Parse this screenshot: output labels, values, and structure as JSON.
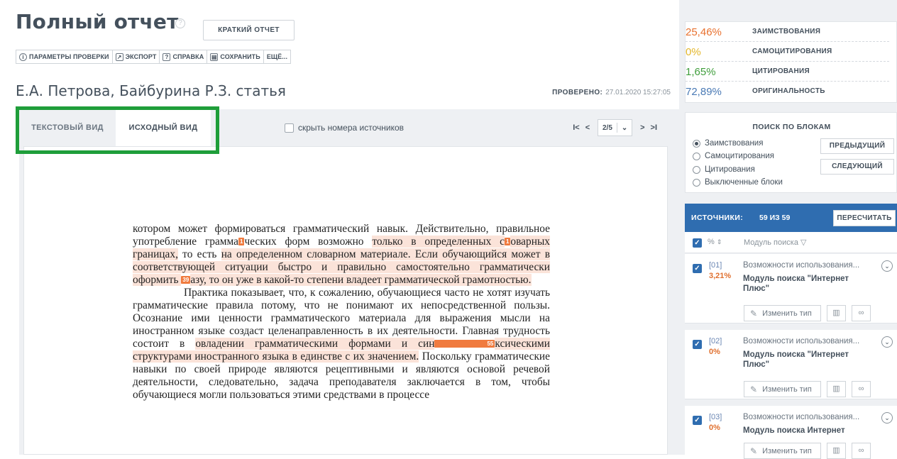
{
  "header": {
    "title": "Полный отчет",
    "short_report": "КРАТКИЙ ОТЧЕТ",
    "toolbar": [
      {
        "icon": "info-icon",
        "glyph": "i",
        "label": "ПАРАМЕТРЫ ПРОВЕРКИ"
      },
      {
        "icon": "export-icon",
        "glyph": "↗",
        "label": "ЭКСПОРТ"
      },
      {
        "icon": "help-icon",
        "glyph": "?",
        "label": "СПРАВКА"
      },
      {
        "icon": "save-icon",
        "glyph": "▤",
        "label": "СОХРАНИТЬ"
      },
      {
        "icon": "",
        "glyph": "",
        "label": "ЕЩЁ..."
      }
    ],
    "doc_name": "Е.А. Петрова, Байбурина Р.З. статья",
    "checked_label": "ПРОВЕРЕНО:",
    "checked_date": "27.01.2020 15:27:05"
  },
  "viewer": {
    "tab_text": "ТЕКСТОВЫЙ ВИД",
    "tab_original": "ИСХОДНЫЙ ВИД",
    "hide_sources": "скрыть номера источников",
    "page_current": "2/5",
    "highlight_color": "#1f9e3a"
  },
  "document": {
    "p1": [
      {
        "t": "котором может формироваться грамматический навык. Действительно, правильное употребление грамма",
        "h": false
      },
      {
        "m": "1"
      },
      {
        "t": "ческих форм возможно ",
        "h": false
      },
      {
        "t": "только в определенных с",
        "h": true
      },
      {
        "m": "1"
      },
      {
        "t": "оварных границах,",
        "h": true
      },
      {
        "t": " то есть ",
        "h": false
      },
      {
        "t": "на определенном словарном материале. Если ",
        "h": true
      },
      {
        "t": "обучающийся может в соответствующей ситуации быстро и правильно самостоятельно грамматически оформить ",
        "h": true
      },
      {
        "m": "39"
      },
      {
        "t": "азу, то он уже в какой-то степени владеет грамматической грамотностью.",
        "h": true
      }
    ],
    "p2": [
      {
        "t": "Практика показывает, что, к сожалению, обучающиеся часто не хотят изучать грамматические правила потому, что не понимают их непосредственной пользы. Осознание ими ценности грамматического материала для выражения мысли на иностранном языке создаст целенаправленность в их деятельности. Главная трудность состоит в ",
        "h": false
      },
      {
        "t": "овладении грамматическими формами и син",
        "h": true
      },
      {
        "m": "55"
      },
      {
        "t": "ксическими структурами иностранного языка в единстве с их значением.",
        "h": true
      },
      {
        "t": " Поскольку грамматические навыки по своей природе являются рецептивными и являются основой речевой деятельности, следовательно, задача преподавателя заключается в том, чтобы обучающиеся могли пользоваться этими средствами в процессе",
        "h": false
      }
    ]
  },
  "stats": [
    {
      "value": "25,46%",
      "label": "ЗАИМСТВОВАНИЯ",
      "color": "#e8712f"
    },
    {
      "value": "0%",
      "label": "САМОЦИТИРОВАНИЯ",
      "color": "#e3b62a"
    },
    {
      "value": "1,65%",
      "label": "ЦИТИРОВАНИЯ",
      "color": "#3f9e3c"
    },
    {
      "value": "72,89%",
      "label": "ОРИГИНАЛЬНОСТЬ",
      "color": "#4a7ab5"
    }
  ],
  "block_search": {
    "title": "ПОИСК ПО БЛОКАМ",
    "options": [
      "Заимствования",
      "Самоцитирования",
      "Цитирования",
      "Выключенные блоки"
    ],
    "prev": "ПРЕДЫДУЩИЙ",
    "next": "СЛЕДУЮЩИЙ"
  },
  "sources": {
    "label": "ИСТОЧНИКИ:",
    "count": "59 ИЗ 59",
    "recount": "ПЕРЕСЧИТАТЬ",
    "col_pct": "%",
    "col_module": "Модуль поиска",
    "change_type": "Изменить тип",
    "items": [
      {
        "num": "[01]",
        "pct": "3,21%",
        "title": "Возможности использования...",
        "module": "Модуль поиска \"Интернет Плюс\""
      },
      {
        "num": "[02]",
        "pct": "0%",
        "title": "Возможности использования...",
        "module": "Модуль поиска \"Интернет Плюс\""
      },
      {
        "num": "[03]",
        "pct": "0%",
        "title": "Возможности использования...",
        "module": "Модуль поиска Интернет"
      }
    ]
  }
}
